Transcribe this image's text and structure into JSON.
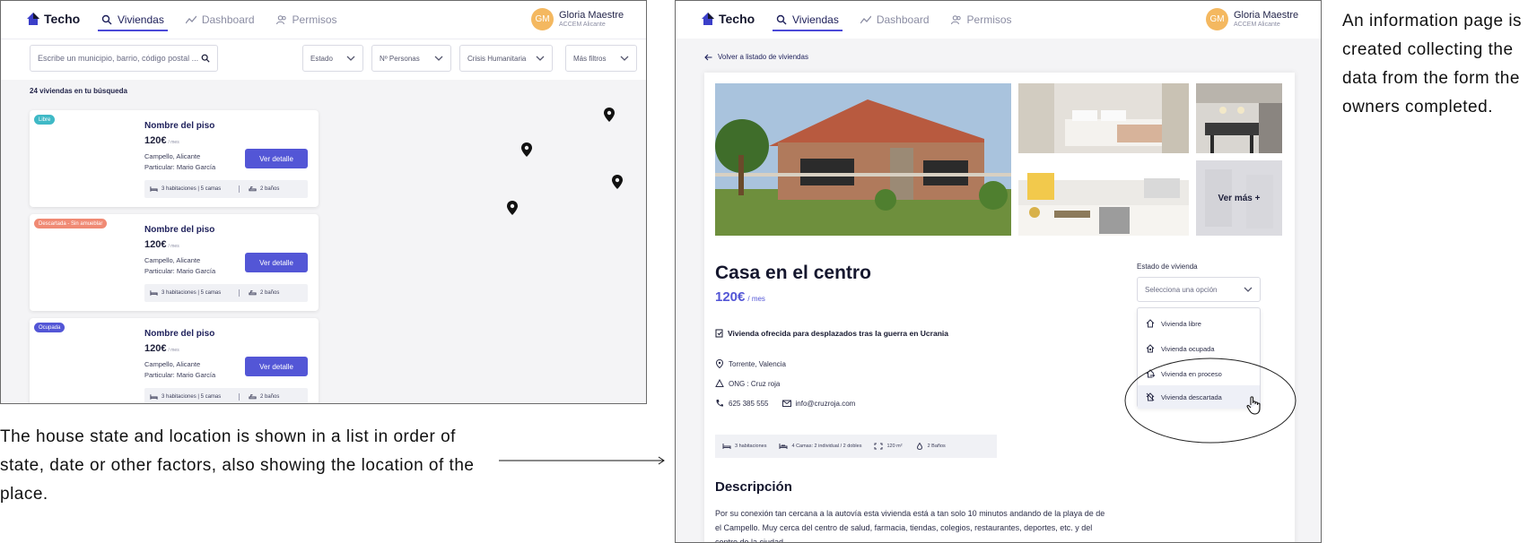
{
  "app": {
    "logo_text": "Techo",
    "nav": [
      {
        "label": "Viviendas",
        "icon": "search-icon",
        "active": true
      },
      {
        "label": "Dashboard",
        "icon": "chart-line-icon",
        "active": false
      },
      {
        "label": "Permisos",
        "icon": "users-icon",
        "active": false
      }
    ],
    "user": {
      "initials": "GM",
      "name": "Gloria Maestre",
      "org": "ACCEM Alicante",
      "avatar_color": "#f4b860"
    },
    "accent": "#5356d6"
  },
  "list_screen": {
    "search_placeholder": "Escribe un municipio, barrio, código postal ...",
    "filters": [
      "Estado",
      "Nº Personas",
      "Crisis Humanitaria",
      "Más filtros"
    ],
    "results_count": "24 viviendas en tu búsqueda",
    "cards": [
      {
        "badge": "Libre",
        "badge_color": "#3fb9c6",
        "title": "Nombre del piso",
        "price": "120€",
        "price_unit": "/ mes",
        "location": "Campello, Alicante",
        "owner": "Particular: Mario García",
        "button": "Ver detalle",
        "rooms": "3 habitaciones | 5 camas",
        "baths": "2 baños"
      },
      {
        "badge": "Descartada - Sin amueblar",
        "badge_color": "#f08a74",
        "title": "Nombre del piso",
        "price": "120€",
        "price_unit": "/ mes",
        "location": "Campello, Alicante",
        "owner": "Particular: Mario García",
        "button": "Ver detalle",
        "rooms": "3 habitaciones | 5 camas",
        "baths": "2 baños"
      },
      {
        "badge": "Ocupada",
        "badge_color": "#5356d6",
        "title": "Nombre del piso",
        "price": "120€",
        "price_unit": "/ mes",
        "location": "Campello, Alicante",
        "owner": "Particular: Mario García",
        "button": "Ver detalle",
        "rooms": "3 habitaciones | 5 camas",
        "baths": "2 baños"
      }
    ]
  },
  "detail_screen": {
    "back_link": "Volver a listado de viviendas",
    "see_more": "Ver más +",
    "title": "Casa en el centro",
    "price": "120€",
    "price_unit": "/ mes",
    "offer_note": "Vivienda ofrecida para desplazados tras la guerra en Ucrania",
    "location": "Torrente, Valencia",
    "ngo": "ONG : Cruz roja",
    "phone": "625 385 555",
    "email": "info@cruzroja.com",
    "features": [
      "3 habitaciones",
      "4 Camas: 2 individual / 2 dobles",
      "120 m²",
      "2 Baños"
    ],
    "description_title": "Descripción",
    "description": "Por su conexión tan cercana a la autovía esta vivienda está a tan solo 10 minutos andando de la playa de de el Campello. Muy cerca del centro de salud, farmacia, tiendas, colegios, restaurantes, deportes, etc. y del centro de la ciudad.",
    "state_label": "Estado de vivienda",
    "state_placeholder": "Selecciona una opción",
    "state_options": [
      "Vivienda libre",
      "Vivienda ocupada",
      "Vivienda en proceso",
      "Vivienda descartada"
    ],
    "hovered_option": "Vivienda descartada"
  },
  "annotations": {
    "left_caption": "The house state and location is shown in a list in order of state, date or other factors, also showing the location of the place.",
    "right_caption": "An information page is created collecting the data from the form the owners completed."
  }
}
